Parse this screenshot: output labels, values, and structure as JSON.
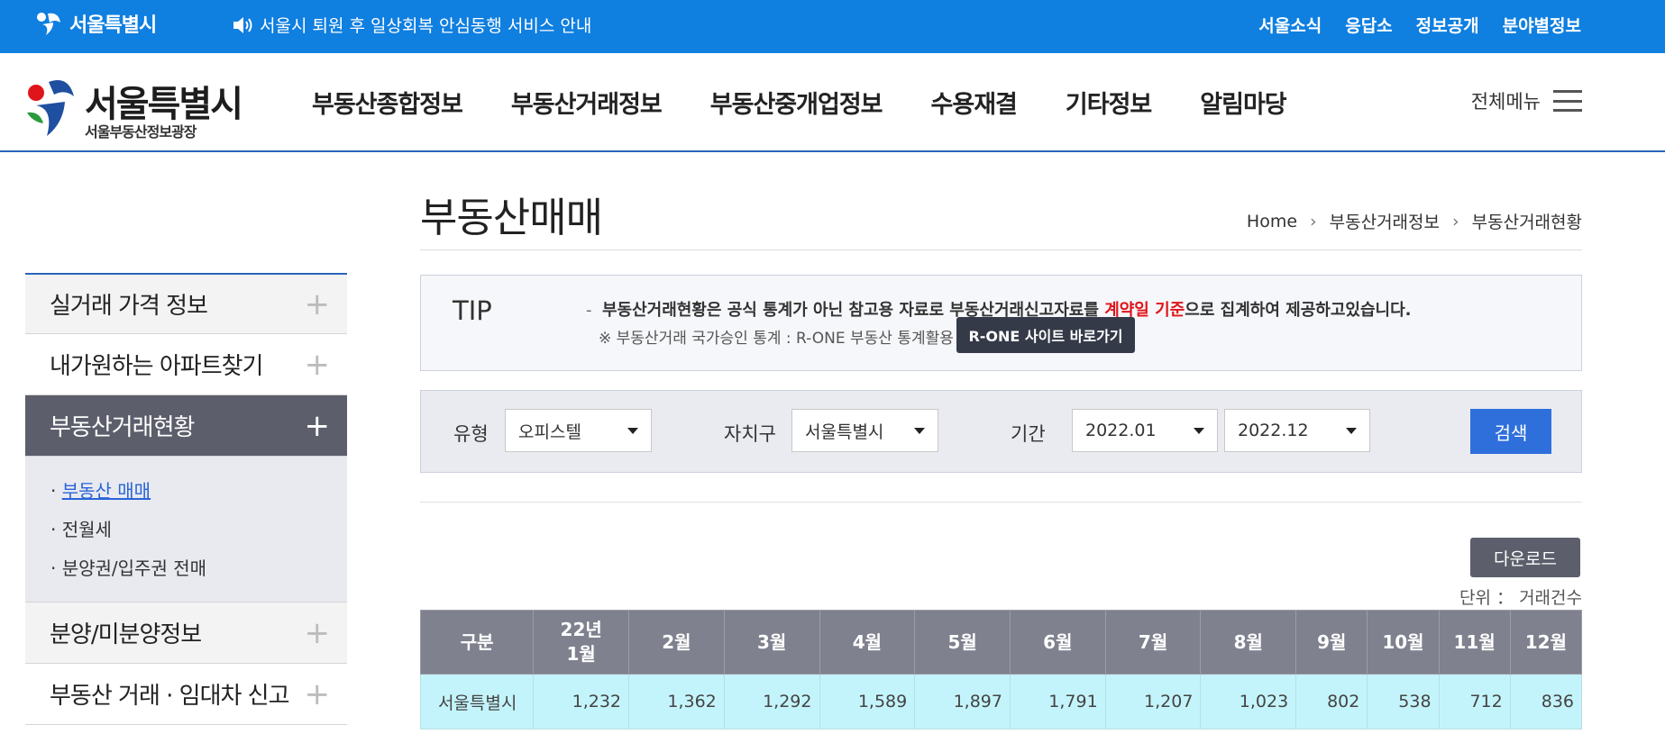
{
  "topbar": {
    "logo": "서울특별시",
    "notice": "서울시 퇴원 후 일상회복 안심동행 서비스 안내",
    "links": [
      "서울소식",
      "응답소",
      "정보공개",
      "분야별정보"
    ]
  },
  "header": {
    "brand_title": "서울특별시",
    "brand_sub": "서울부동산정보광장",
    "nav": [
      "부동산종합정보",
      "부동산거래정보",
      "부동산중개업정보",
      "수용재결",
      "기타정보",
      "알림마당"
    ],
    "all_menu": "전체메뉴"
  },
  "sidebar": {
    "items": [
      "실거래 가격 정보",
      "내가원하는 아파트찾기",
      "부동산거래현황",
      "분양/미분양정보",
      "부동산 거래 · 임대차 신고"
    ],
    "sub_items": [
      "부동산 매매",
      "전월세",
      "분양권/입주권 전매"
    ]
  },
  "page": {
    "title": "부동산매매",
    "breadcrumb": [
      "Home",
      "부동산거래정보",
      "부동산거래현황"
    ]
  },
  "tip": {
    "label": "TIP",
    "line1_pre": "부동산거래현황은 공식 통계가 아닌 참고용 자료로 부동산거래신고자료를 ",
    "line1_red": "계약일 기준",
    "line1_post": "으로 집계하여 제공하고있습니다.",
    "line2": "※ 부동산거래 국가승인 통계 : R-ONE 부동산 통계활용",
    "rone_button": "R-ONE 사이트 바로가기"
  },
  "search": {
    "type_label": "유형",
    "type_value": "오피스텔",
    "district_label": "자치구",
    "district_value": "서울특별시",
    "period_label": "기간",
    "period_from": "2022.01",
    "period_to": "2022.12",
    "button": "검색"
  },
  "table": {
    "download": "다운로드",
    "unit": "단위 ： 거래건수",
    "headers": [
      "구분",
      "22년\n1월",
      "2월",
      "3월",
      "4월",
      "5월",
      "6월",
      "7월",
      "8월",
      "9월",
      "10월",
      "11월",
      "12월"
    ],
    "row": [
      "서울특별시",
      "1,232",
      "1,362",
      "1,292",
      "1,589",
      "1,897",
      "1,791",
      "1,207",
      "1,023",
      "802",
      "538",
      "712",
      "836"
    ]
  },
  "colors": {
    "accent": "#0f7fe0",
    "header_bar": "#7f828e",
    "row_bg": "#c4f4fb",
    "active_side": "#5c5f6b",
    "highlight_red": "#e0151b"
  }
}
